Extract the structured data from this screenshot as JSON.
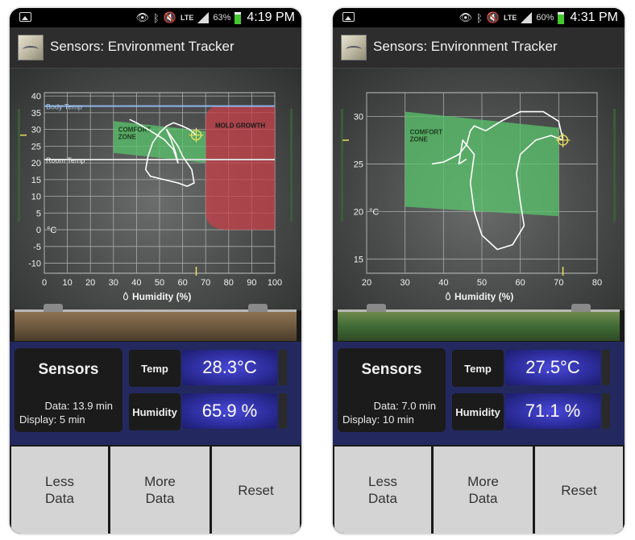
{
  "colors": {
    "comfort_zone": "#58c06a",
    "mold_zone": "#c8404a",
    "trace": "#ffffff",
    "panel_bg": "#23295e",
    "value_bg": "#3a3ac8",
    "button_bg": "#d4d4d4"
  },
  "screens": [
    {
      "status_bar": {
        "icons": [
          "image-icon",
          "eye-icon",
          "bluetooth-icon",
          "mute-icon",
          "lte-icon",
          "signal-icon",
          "battery-icon"
        ],
        "lte": "LTE",
        "battery": "63%",
        "time": "4:19 PM"
      },
      "app_bar": {
        "title": "Sensors: Environment Tracker"
      },
      "chart": {
        "x_min": 0,
        "x_max": 100,
        "y_min": -13,
        "y_max": 41,
        "x_ticks": [
          0,
          10,
          20,
          30,
          40,
          50,
          60,
          70,
          80,
          90,
          100
        ],
        "y_ticks": [
          40,
          35,
          30,
          25,
          20,
          15,
          10,
          5,
          0,
          -5,
          -10
        ],
        "x_label": "Humidity (%)",
        "x_label_icon": "water-drop-icon",
        "zero_label": "C",
        "ref_lines": [
          {
            "label": "Body Temp",
            "y": 37
          },
          {
            "label": "Room Temp",
            "y": 21
          }
        ],
        "comfort": {
          "label_1": "COMFORT",
          "label_2": "ZONE",
          "x0": 30,
          "x1": 70,
          "y0_top": 32.5,
          "y0_bot": 23,
          "y1_top": 29.5,
          "y1_bot": 20
        },
        "mold": {
          "label": "MOLD GROWTH",
          "x0": 70,
          "x1": 100,
          "y_top": 37,
          "y_bottom": 0
        },
        "trace": [
          [
            37,
            33
          ],
          [
            40,
            32
          ],
          [
            45,
            30
          ],
          [
            52,
            27
          ],
          [
            56,
            24
          ],
          [
            58,
            20
          ],
          [
            57,
            23
          ],
          [
            55,
            27
          ],
          [
            53,
            30
          ],
          [
            55,
            28
          ],
          [
            58,
            25
          ],
          [
            60,
            22
          ],
          [
            64,
            18
          ],
          [
            65,
            14
          ],
          [
            62,
            13
          ],
          [
            58,
            14
          ],
          [
            52,
            15
          ],
          [
            46,
            16
          ],
          [
            44,
            18
          ],
          [
            45,
            22
          ],
          [
            47,
            26
          ],
          [
            50,
            29
          ],
          [
            53,
            31
          ],
          [
            56,
            32
          ],
          [
            60,
            31
          ],
          [
            63,
            30
          ],
          [
            65.9,
            28.3
          ]
        ],
        "cursor": [
          65.9,
          28.3
        ]
      },
      "panel": {
        "title": "Sensors",
        "data": "Data: 13.9 min",
        "display": "Display: 5 min",
        "temp_label": "Temp",
        "temp_value": "28.3°C",
        "humidity_label": "Humidity",
        "humidity_value": "65.9 %"
      },
      "buttons": {
        "less_1": "Less",
        "less_2": "Data",
        "more_1": "More",
        "more_2": "Data",
        "reset": "Reset"
      }
    },
    {
      "status_bar": {
        "icons": [
          "image-icon",
          "eye-icon",
          "bluetooth-icon",
          "mute-icon",
          "lte-icon",
          "signal-icon",
          "battery-icon"
        ],
        "lte": "LTE",
        "battery": "60%",
        "time": "4:31 PM"
      },
      "app_bar": {
        "title": "Sensors: Environment Tracker"
      },
      "chart": {
        "x_min": 20,
        "x_max": 80,
        "y_min": 13.5,
        "y_max": 32.5,
        "x_ticks": [
          20,
          30,
          40,
          50,
          60,
          70,
          80
        ],
        "y_ticks": [
          30,
          25,
          20,
          15
        ],
        "x_label": "Humidity (%)",
        "x_label_icon": "water-drop-icon",
        "zero_label": "C",
        "ref_lines": [],
        "comfort": {
          "label_1": "COMFORT",
          "label_2": "ZONE",
          "x0": 30,
          "x1": 70,
          "y0_top": 30.5,
          "y0_bot": 20.5,
          "y1_top": 28.8,
          "y1_bot": 19.5
        },
        "mold": null,
        "trace": [
          [
            37,
            25
          ],
          [
            40,
            25.2
          ],
          [
            44,
            26
          ],
          [
            46,
            27
          ],
          [
            47,
            28.5
          ],
          [
            48,
            29
          ],
          [
            51,
            28.5
          ],
          [
            55,
            29.5
          ],
          [
            60,
            30.5
          ],
          [
            66,
            30.5
          ],
          [
            70,
            29.5
          ],
          [
            71.1,
            27.5
          ],
          [
            68,
            28
          ],
          [
            64,
            27.5
          ],
          [
            60,
            26
          ],
          [
            59,
            24
          ],
          [
            60,
            21
          ],
          [
            61,
            18.5
          ],
          [
            58,
            16.5
          ],
          [
            54,
            16
          ],
          [
            50,
            17.5
          ],
          [
            48,
            20
          ],
          [
            47,
            23
          ],
          [
            48,
            26
          ],
          [
            45,
            27.5
          ],
          [
            44,
            25
          ],
          [
            46,
            25.5
          ]
        ],
        "cursor": [
          71.1,
          27.5
        ]
      },
      "panel": {
        "title": "Sensors",
        "data": "Data: 7.0 min",
        "display": "Display: 10 min",
        "temp_label": "Temp",
        "temp_value": "27.5°C",
        "humidity_label": "Humidity",
        "humidity_value": "71.1 %"
      },
      "buttons": {
        "less_1": "Less",
        "less_2": "Data",
        "more_1": "More",
        "more_2": "Data",
        "reset": "Reset"
      }
    }
  ]
}
